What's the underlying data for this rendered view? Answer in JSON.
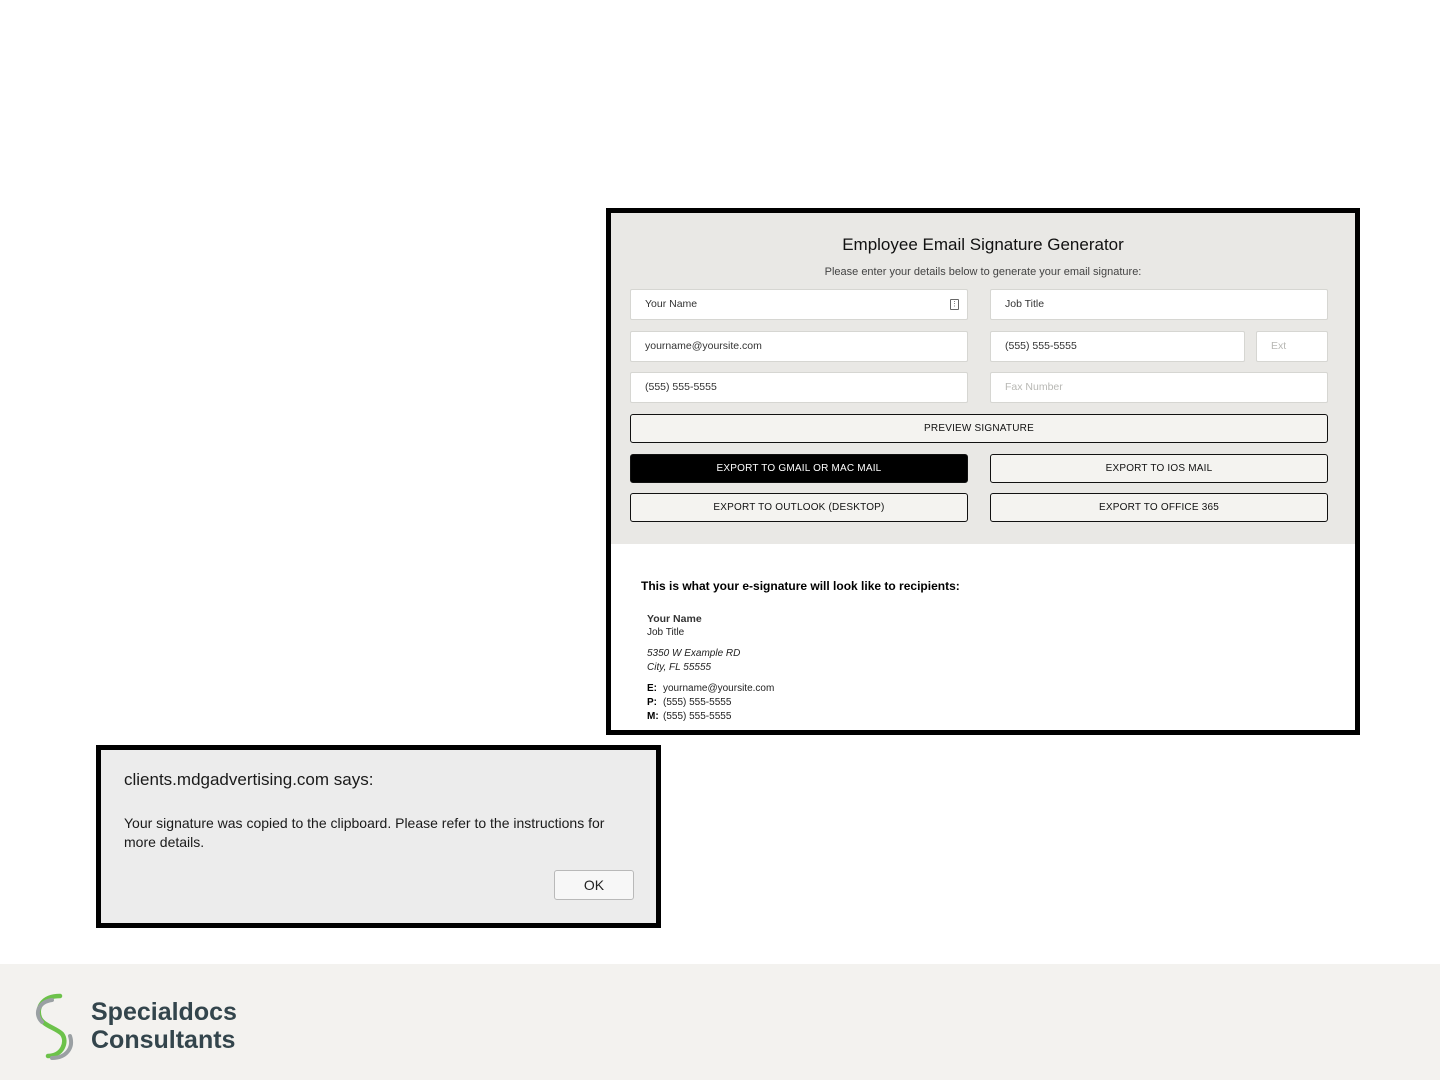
{
  "colors": {
    "form_background": "#e9e8e5",
    "primary_button": "#000000",
    "footer_background": "#f3f2ef",
    "logo_text": "#33454c",
    "logo_green": "#6cc24a",
    "logo_gray": "#9aa0a3"
  },
  "generator": {
    "title": "Employee Email Signature Generator",
    "subtitle": "Please enter your details below to generate your email signature:",
    "fields": {
      "name": "Your Name",
      "job_title": "Job Title",
      "email": "yourname@yoursite.com",
      "phone": "(555) 555-5555",
      "ext_placeholder": "Ext",
      "mobile": "(555) 555-5555",
      "fax_placeholder": "Fax Number"
    },
    "buttons": {
      "preview": "PREVIEW SIGNATURE",
      "gmail": "EXPORT TO GMAIL OR MAC MAIL",
      "ios": "EXPORT TO IOS MAIL",
      "outlook": "EXPORT TO OUTLOOK (DESKTOP)",
      "office365": "EXPORT TO OFFICE 365"
    },
    "preview": {
      "intro": "This is what your e-signature will look like to recipients:",
      "name": "Your Name",
      "title": "Job Title",
      "address_line1": "5350 W Example RD",
      "address_line2": "City, FL 55555",
      "email_label": "E:",
      "email": "yourname@yoursite.com",
      "phone_label": "P:",
      "phone": "(555) 555-5555",
      "mobile_label": "M:",
      "mobile": "(555) 555-5555"
    }
  },
  "alert": {
    "title": "clients.mdgadvertising.com says:",
    "message": "Your signature was copied to the clipboard. Please refer to the instructions for more details.",
    "ok_label": "OK"
  },
  "footer": {
    "logo_line1": "Specialdocs",
    "logo_line2": "Consultants",
    "logo_icon": "specialdocs-s-logo-icon"
  }
}
